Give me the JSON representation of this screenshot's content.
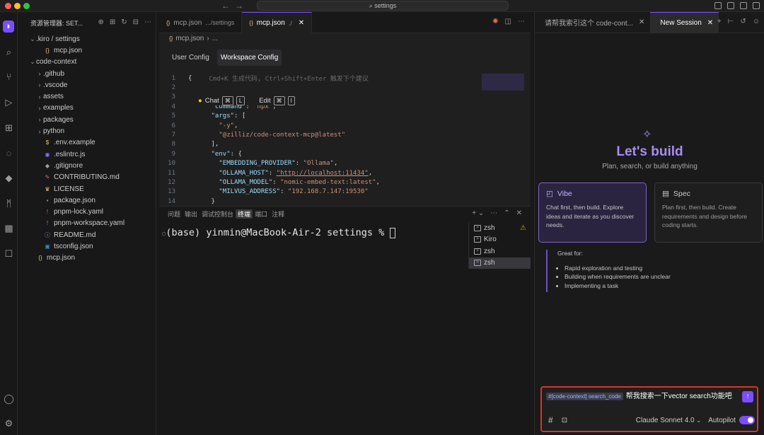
{
  "titlebar": {
    "search_text": "settings"
  },
  "explorer": {
    "header": "资源管理器: SET...",
    "tree": [
      {
        "label": ".kiro / settings",
        "chev": "⌄",
        "indent": 0,
        "icon": "folder-open"
      },
      {
        "label": "mcp.json",
        "chev": "",
        "indent": 1,
        "icon": "json-braces"
      },
      {
        "label": "code-context",
        "chev": "⌄",
        "indent": 0,
        "icon": "folder-open"
      },
      {
        "label": ".github",
        "chev": "›",
        "indent": 1,
        "icon": "folder"
      },
      {
        "label": ".vscode",
        "chev": "›",
        "indent": 1,
        "icon": "folder"
      },
      {
        "label": "assets",
        "chev": "›",
        "indent": 1,
        "icon": "folder"
      },
      {
        "label": "examples",
        "chev": "›",
        "indent": 1,
        "icon": "folder"
      },
      {
        "label": "packages",
        "chev": "›",
        "indent": 1,
        "icon": "folder"
      },
      {
        "label": "python",
        "chev": "›",
        "indent": 1,
        "icon": "folder"
      },
      {
        "label": ".env.example",
        "chev": "",
        "indent": 1,
        "icon": "dollar"
      },
      {
        "label": ".eslintrc.js",
        "chev": "",
        "indent": 1,
        "icon": "eslint"
      },
      {
        "label": ".gitignore",
        "chev": "",
        "indent": 1,
        "icon": "git"
      },
      {
        "label": "CONTRIBUTING.md",
        "chev": "",
        "indent": 1,
        "icon": "contributing"
      },
      {
        "label": "LICENSE",
        "chev": "",
        "indent": 1,
        "icon": "license"
      },
      {
        "label": "package.json",
        "chev": "",
        "indent": 1,
        "icon": "npm"
      },
      {
        "label": "pnpm-lock.yaml",
        "chev": "",
        "indent": 1,
        "icon": "exclamation"
      },
      {
        "label": "pnpm-workspace.yaml",
        "chev": "",
        "indent": 1,
        "icon": "exclamation"
      },
      {
        "label": "README.md",
        "chev": "",
        "indent": 1,
        "icon": "info"
      },
      {
        "label": "tsconfig.json",
        "chev": "",
        "indent": 1,
        "icon": "ts"
      },
      {
        "label": "mcp.json",
        "chev": "",
        "indent": 0,
        "icon": "json-braces"
      }
    ]
  },
  "editor": {
    "tabs": [
      {
        "name": "mcp.json",
        "path": ".../settings",
        "active": false
      },
      {
        "name": "mcp.json",
        "path": "./",
        "active": true
      }
    ],
    "breadcrumb": [
      "mcp.json",
      "..."
    ],
    "config_tabs": [
      "User Config",
      "Workspace Config"
    ],
    "code_hint": "Cmd+K 生成代码, Ctrl+Shift+Enter 触发下个建议",
    "chat_hint": {
      "chat": "Chat",
      "chat_key": "L",
      "edit": "Edit",
      "edit_key": "I",
      "cmd_symbol": "⌘"
    },
    "lines": [
      {
        "n": "1",
        "text": "{"
      },
      {
        "n": "2",
        "text": ""
      },
      {
        "n": "3",
        "text": ""
      },
      {
        "n": "4",
        "key": "\"command\"",
        "val": "\"npx\"",
        "tail": ","
      },
      {
        "n": "5",
        "key": "\"args\"",
        "val": "",
        "tail": "["
      },
      {
        "n": "6",
        "key": "",
        "val": "\"-y\"",
        "tail": ","
      },
      {
        "n": "7",
        "key": "",
        "val": "\"@zilliz/code-context-mcp@latest\"",
        "tail": ""
      },
      {
        "n": "8",
        "key": "",
        "val": "",
        "tail": "],"
      },
      {
        "n": "9",
        "key": "\"env\"",
        "val": "",
        "tail": "{"
      },
      {
        "n": "10",
        "key": "\"EMBEDDING_PROVIDER\"",
        "val": "\"Ollama\"",
        "tail": ","
      },
      {
        "n": "11",
        "key": "\"OLLAMA_HOST\"",
        "val": "\"http://localhost:11434\"",
        "tail": ","
      },
      {
        "n": "12",
        "key": "\"OLLAMA_MODEL\"",
        "val": "\"nomic-embed-text:latest\"",
        "tail": ","
      },
      {
        "n": "13",
        "key": "\"MILVUS_ADDRESS\"",
        "val": "\"192.168.7.147:19530\"",
        "tail": ""
      },
      {
        "n": "14",
        "key": "",
        "val": "",
        "tail": "}"
      }
    ]
  },
  "panel": {
    "tabs": [
      "问题",
      "输出",
      "调试控制台",
      "终端",
      "端口",
      "注释"
    ],
    "active_tab": "终端",
    "prompt": "(base) yinmin@MacBook-Air-2 settings % ",
    "terminals": [
      {
        "label": "zsh",
        "warn": true
      },
      {
        "label": "Kiro",
        "warn": false
      },
      {
        "label": "zsh",
        "warn": false
      },
      {
        "label": "zsh",
        "warn": false
      }
    ]
  },
  "chat": {
    "tabs": [
      {
        "label": "请帮我索引这个 code-cont...",
        "active": false
      },
      {
        "label": "New Session",
        "active": true
      }
    ],
    "title": "Let's build",
    "subtitle": "Plan, search, or build anything",
    "vibe": {
      "title": "Vibe",
      "desc": "Chat first, then build. Explore ideas and iterate as you discover needs."
    },
    "spec": {
      "title": "Spec",
      "desc": "Plan first, then build. Create requirements and design before coding starts."
    },
    "great_for": {
      "heading": "Great for:",
      "items": [
        "Rapid exploration and testing",
        "Building when requirements are unclear",
        "Implementing a task"
      ]
    },
    "input": {
      "chip": "#[code-context] search_code",
      "text": "帮我搜索一下vector search功能吧",
      "model": "Claude Sonnet 4.0",
      "autopilot": "Autopilot",
      "autopilot_on": true
    }
  },
  "colors": {
    "accent": "#7c4dff",
    "highlight_border": "#d9342b",
    "brand_title": "#a98cf5"
  }
}
